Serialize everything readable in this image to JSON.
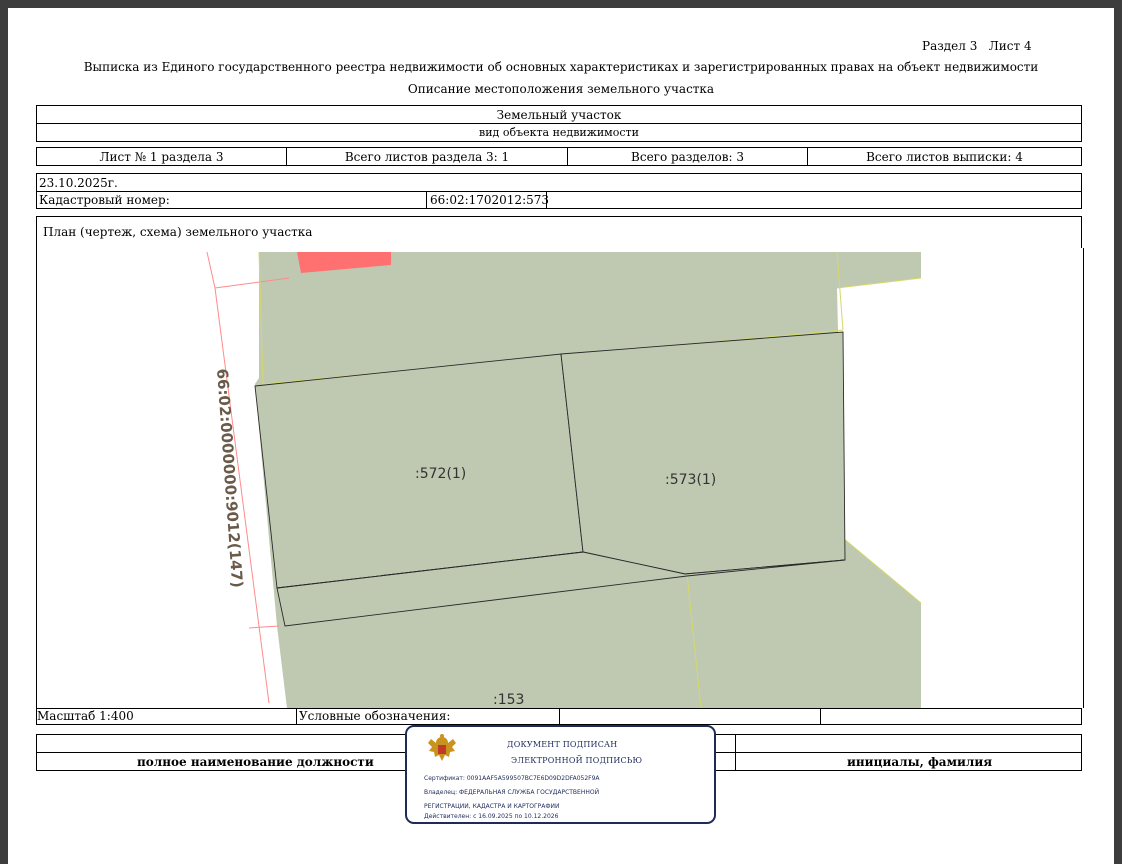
{
  "header": {
    "section_sheet": "Раздел 3   Лист 4",
    "title": "Выписка из Единого государственного реестра недвижимости об основных характеристиках и зарегистрированных правах на объект недвижимости",
    "subtitle": "Описание местоположения земельного участка"
  },
  "object": {
    "type": "Земельный участок",
    "type_caption": "вид объекта недвижимости"
  },
  "sheets": {
    "sheet": "Лист № 1 раздела 3",
    "total_section": "Всего листов раздела 3: 1",
    "total_sections": "Всего разделов: 3",
    "total_extract": "Всего листов выписки: 4"
  },
  "info": {
    "date": "23.10.2025г.",
    "cadastral_label": "Кадастровый номер:",
    "cadastral_value": "66:02:1702012:573"
  },
  "plan": {
    "title": "План (чертеж, схема) земельного участка",
    "labels": {
      "road": "66:02:0000000:9012(147)",
      "parcel_572": ":572(1)",
      "parcel_573": ":573(1)",
      "parcel_153": ":153"
    },
    "colors": {
      "parcel_fill": "#bfc9b2",
      "highlight": "#ff7070",
      "boundary_red": "#ff8b8b"
    }
  },
  "footer": {
    "scale": "Масштаб 1:400",
    "legend_label": "Условные обозначения:",
    "position_caption": "полное наименование должности",
    "initials_caption": "инициалы, фамилия"
  },
  "stamp": {
    "line1": "ДОКУМЕНТ ПОДПИСАН",
    "line2": "ЭЛЕКТРОННОЙ ПОДПИСЬЮ",
    "certificate": "Сертификат: 0091AAF5A599507BC7E6D09D2DFA052F9A",
    "owner_1": "Владелец: ФЕДЕРАЛЬНАЯ СЛУЖБА ГОСУДАРСТВЕННОЙ",
    "owner_2": "РЕГИСТРАЦИИ, КАДАСТРА И КАРТОГРАФИИ",
    "valid": "Действителен: с 16.09.2025 по 10.12.2026",
    "border_color": "#1e2a5a"
  }
}
